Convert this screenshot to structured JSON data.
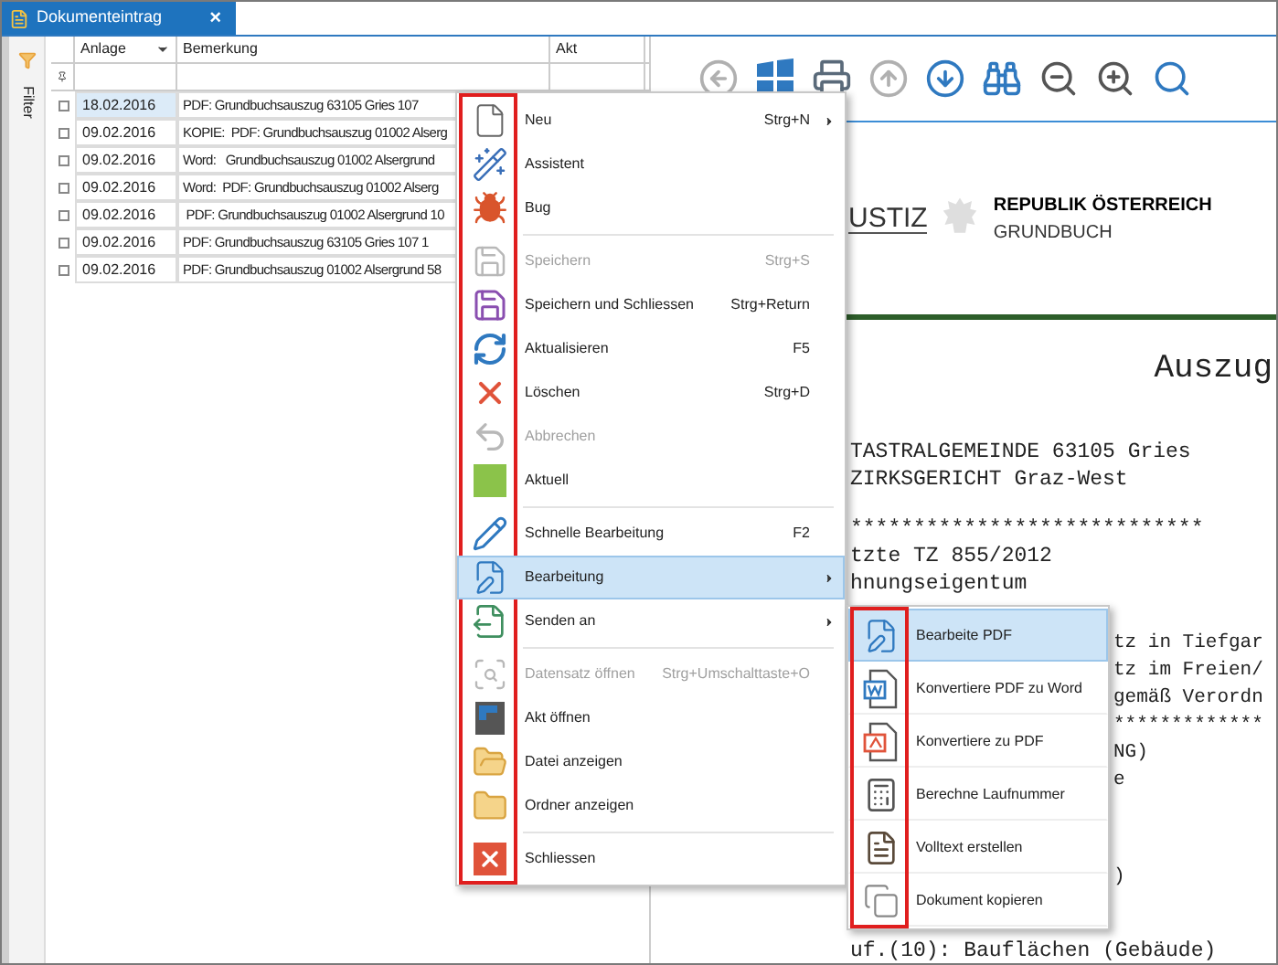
{
  "tab": {
    "title": "Dokumenteintrag",
    "close": "×",
    "selected": true
  },
  "filter_panel": {
    "label": "Filter"
  },
  "table": {
    "columns": [
      {
        "label": "Anlage",
        "sort_menu": true
      },
      {
        "label": "Bemerkung",
        "sort_menu": false
      },
      {
        "label": "Akt",
        "sort_menu": false
      }
    ],
    "rows": [
      {
        "checked": false,
        "selected": true,
        "date": "18.02.2016",
        "remark": "PDF: Grundbuchsauszug 63105 Gries 107"
      },
      {
        "checked": false,
        "selected": false,
        "date": "09.02.2016",
        "remark": "KOPIE:  PDF: Grundbuchsauszug 01002 Alserg"
      },
      {
        "checked": false,
        "selected": false,
        "date": "09.02.2016",
        "remark": "Word:   Grundbuchsauszug 01002 Alsergrund"
      },
      {
        "checked": false,
        "selected": false,
        "date": "09.02.2016",
        "remark": "Word:  PDF: Grundbuchsauszug 01002 Alserg"
      },
      {
        "checked": false,
        "selected": false,
        "date": "09.02.2016",
        "remark": " PDF: Grundbuchsauszug 01002 Alsergrund 10"
      },
      {
        "checked": false,
        "selected": false,
        "date": "09.02.2016",
        "remark": "PDF: Grundbuchsauszug 63105 Gries 107 1"
      },
      {
        "checked": false,
        "selected": false,
        "date": "09.02.2016",
        "remark": "PDF: Grundbuchsauszug 01002 Alsergrund 58"
      }
    ]
  },
  "toolbar": [
    {
      "disabled": true
    },
    {
      "disabled": false
    },
    {
      "disabled": false
    },
    {
      "disabled": true
    },
    {
      "disabled": false
    },
    {
      "disabled": false
    },
    {
      "disabled": false
    },
    {
      "disabled": false
    },
    {
      "disabled": false
    }
  ],
  "document": {
    "logo_text": "USTIZ",
    "header_title": "REPUBLIK ÖSTERREICH",
    "header_subtitle": "GRUNDBUCH",
    "heading": "Auszug",
    "groups": [
      {
        "beside_menu": false,
        "lines": [
          "TASTRALGEMEINDE 63105 Gries",
          "ZIRKSGERICHT Graz-West"
        ]
      },
      {
        "beside_menu": false,
        "lines": [
          "****************************",
          "tzte TZ 855/2012",
          "hnungseigentum"
        ]
      },
      {
        "beside_menu": true,
        "lines": [
          "tz in Tiefgar",
          "tz im Freien/",
          "gemäß Verordn",
          "*************",
          "NG)",
          "e"
        ]
      },
      {
        "beside_menu": true,
        "lines": [
          ")"
        ]
      },
      {
        "beside_menu": false,
        "lines": [
          "uf.(10): Bauflächen (Gebäude)"
        ]
      }
    ]
  },
  "context_menu": [
    {
      "kind": "item",
      "label": "Neu",
      "shortcut": "Strg+N",
      "submenu": true,
      "disabled": false,
      "selected": false
    },
    {
      "kind": "item",
      "label": "Assistent",
      "submenu": false,
      "disabled": false,
      "selected": false
    },
    {
      "kind": "item",
      "label": "Bug",
      "submenu": false,
      "disabled": false,
      "selected": false
    },
    {
      "kind": "separator"
    },
    {
      "kind": "item",
      "label": "Speichern",
      "shortcut": "Strg+S",
      "submenu": false,
      "disabled": true,
      "selected": false
    },
    {
      "kind": "item",
      "label": "Speichern und Schliessen",
      "shortcut": "Strg+Return",
      "submenu": false,
      "disabled": false,
      "selected": false
    },
    {
      "kind": "item",
      "label": "Aktualisieren",
      "shortcut": "F5",
      "submenu": false,
      "disabled": false,
      "selected": false
    },
    {
      "kind": "item",
      "label": "Löschen",
      "shortcut": "Strg+D",
      "submenu": false,
      "disabled": false,
      "selected": false
    },
    {
      "kind": "item",
      "label": "Abbrechen",
      "submenu": false,
      "disabled": true,
      "selected": false
    },
    {
      "kind": "item",
      "label": "Aktuell",
      "submenu": false,
      "disabled": false,
      "selected": false
    },
    {
      "kind": "separator"
    },
    {
      "kind": "item",
      "label": "Schnelle Bearbeitung",
      "shortcut": "F2",
      "submenu": false,
      "disabled": false,
      "selected": false
    },
    {
      "kind": "item",
      "label": "Bearbeitung",
      "submenu": true,
      "disabled": false,
      "selected": true
    },
    {
      "kind": "item",
      "label": "Senden an",
      "submenu": true,
      "disabled": false,
      "selected": false
    },
    {
      "kind": "separator"
    },
    {
      "kind": "item",
      "label": "Datensatz öffnen",
      "shortcut": "Strg+Umschalttaste+O",
      "submenu": false,
      "disabled": true,
      "selected": false
    },
    {
      "kind": "item",
      "label": "Akt öffnen",
      "submenu": false,
      "disabled": false,
      "selected": false
    },
    {
      "kind": "item",
      "label": "Datei anzeigen",
      "submenu": false,
      "disabled": false,
      "selected": false
    },
    {
      "kind": "item",
      "label": "Ordner anzeigen",
      "submenu": false,
      "disabled": false,
      "selected": false
    },
    {
      "kind": "separator"
    },
    {
      "kind": "item",
      "label": "Schliessen",
      "submenu": false,
      "disabled": false,
      "selected": false
    }
  ],
  "submenu": [
    {
      "label": "Bearbeite PDF",
      "selected": true
    },
    {
      "label": "Konvertiere PDF zu Word",
      "selected": false
    },
    {
      "label": "Konvertiere zu PDF",
      "selected": false
    },
    {
      "label": "Berechne Laufnummer",
      "selected": false
    },
    {
      "label": "Volltext erstellen",
      "selected": false
    },
    {
      "label": "Dokument kopieren",
      "selected": false
    }
  ]
}
